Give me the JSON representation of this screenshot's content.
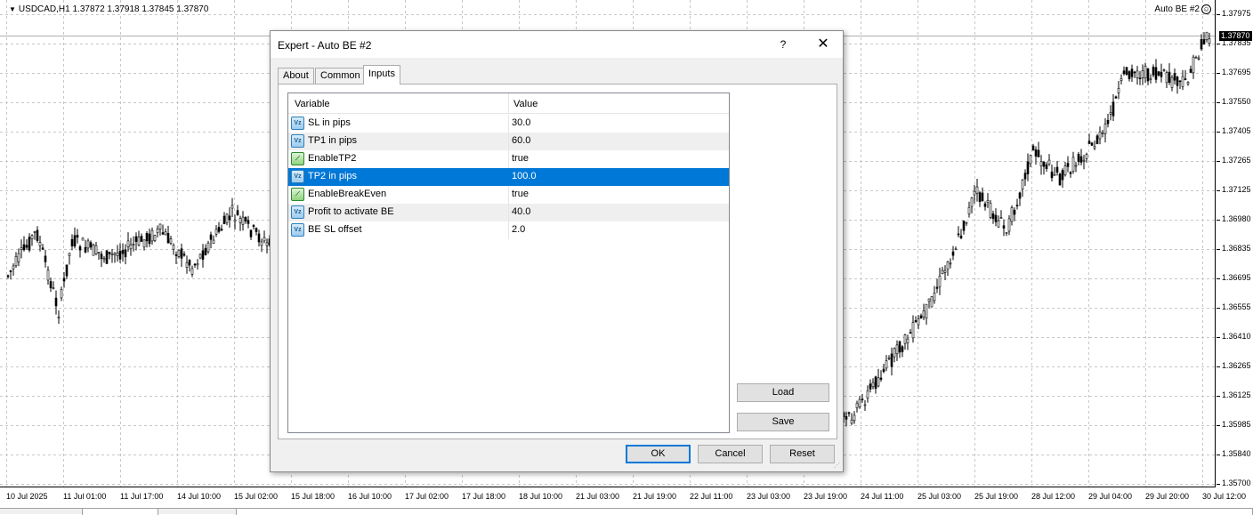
{
  "chart": {
    "symbol_info": "USDCAD,H1  1.37872 1.37918 1.37845 1.37870",
    "ea_label": "Auto BE #2",
    "current_price": "1.37870",
    "price_labels": [
      "1.37975",
      "1.37835",
      "1.37695",
      "1.37550",
      "1.37405",
      "1.37265",
      "1.37125",
      "1.36980",
      "1.36835",
      "1.36695",
      "1.36555",
      "1.36410",
      "1.36265",
      "1.36125",
      "1.35985",
      "1.35840",
      "1.35700"
    ],
    "time_labels": [
      "10 Jul 2025",
      "11 Jul 01:00",
      "11 Jul 17:00",
      "14 Jul 10:00",
      "15 Jul 02:00",
      "15 Jul 18:00",
      "16 Jul 10:00",
      "17 Jul 02:00",
      "17 Jul 18:00",
      "18 Jul 10:00",
      "21 Jul 03:00",
      "21 Jul 19:00",
      "22 Jul 11:00",
      "23 Jul 03:00",
      "23 Jul 19:00",
      "24 Jul 11:00",
      "25 Jul 03:00",
      "25 Jul 19:00",
      "28 Jul 12:00",
      "29 Jul 04:00",
      "29 Jul 20:00",
      "30 Jul 12:00"
    ],
    "colors": {
      "candle": "#000000",
      "grid": "#c8c8c8",
      "background": "#ffffff"
    }
  },
  "dialog": {
    "title": "Expert - Auto BE #2",
    "help_label": "?",
    "close_label": "✕",
    "tabs": [
      {
        "label": "About",
        "active": false
      },
      {
        "label": "Common",
        "active": false
      },
      {
        "label": "Inputs",
        "active": true
      }
    ],
    "columns": {
      "variable": "Variable",
      "value": "Value"
    },
    "inputs": [
      {
        "name": "SL in pips",
        "value": "30.0",
        "icon": "double-value-icon"
      },
      {
        "name": "TP1 in pips",
        "value": "60.0",
        "icon": "double-value-icon"
      },
      {
        "name": "EnableTP2",
        "value": "true",
        "icon": "boolean-value-icon"
      },
      {
        "name": "TP2 in pips",
        "value": "100.0",
        "icon": "double-value-icon"
      },
      {
        "name": "EnableBreakEven",
        "value": "true",
        "icon": "boolean-value-icon"
      },
      {
        "name": "Profit to activate BE",
        "value": "40.0",
        "icon": "double-value-icon"
      },
      {
        "name": "BE SL offset",
        "value": "2.0",
        "icon": "double-value-icon"
      }
    ],
    "selected_index": 3,
    "buttons": {
      "load": "Load",
      "save": "Save",
      "ok": "OK",
      "cancel": "Cancel",
      "reset": "Reset"
    },
    "accent_color": "#0078d7"
  }
}
